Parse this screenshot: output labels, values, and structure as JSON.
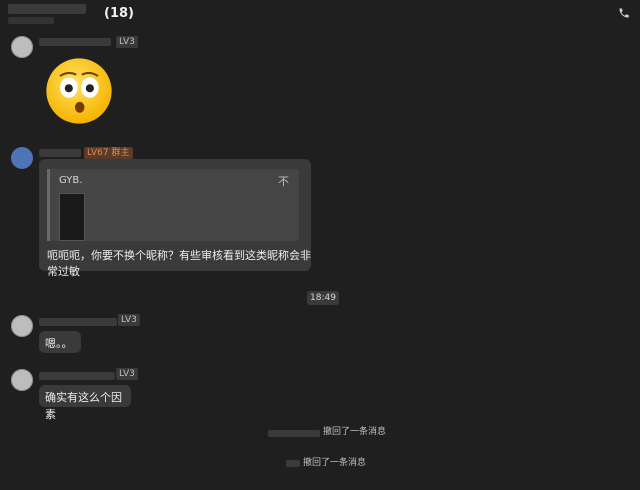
{
  "header": {
    "count": "(18)"
  },
  "messages": [
    {
      "level": "LV3"
    },
    {
      "level": "LV67 群主",
      "quote_name": "GYB.",
      "quote_icon": "不",
      "text": "呃呃呃，你要不换个昵称？有些审核看到这类昵称会非常过敏"
    },
    {
      "time": "18:49"
    },
    {
      "level": "LV3",
      "text": "嗯。。"
    },
    {
      "level": "LV3",
      "text": "确实有这么个因素"
    }
  ],
  "system": [
    {
      "text": "撤回了一条消息"
    },
    {
      "text": "撤回了一条消息"
    }
  ]
}
